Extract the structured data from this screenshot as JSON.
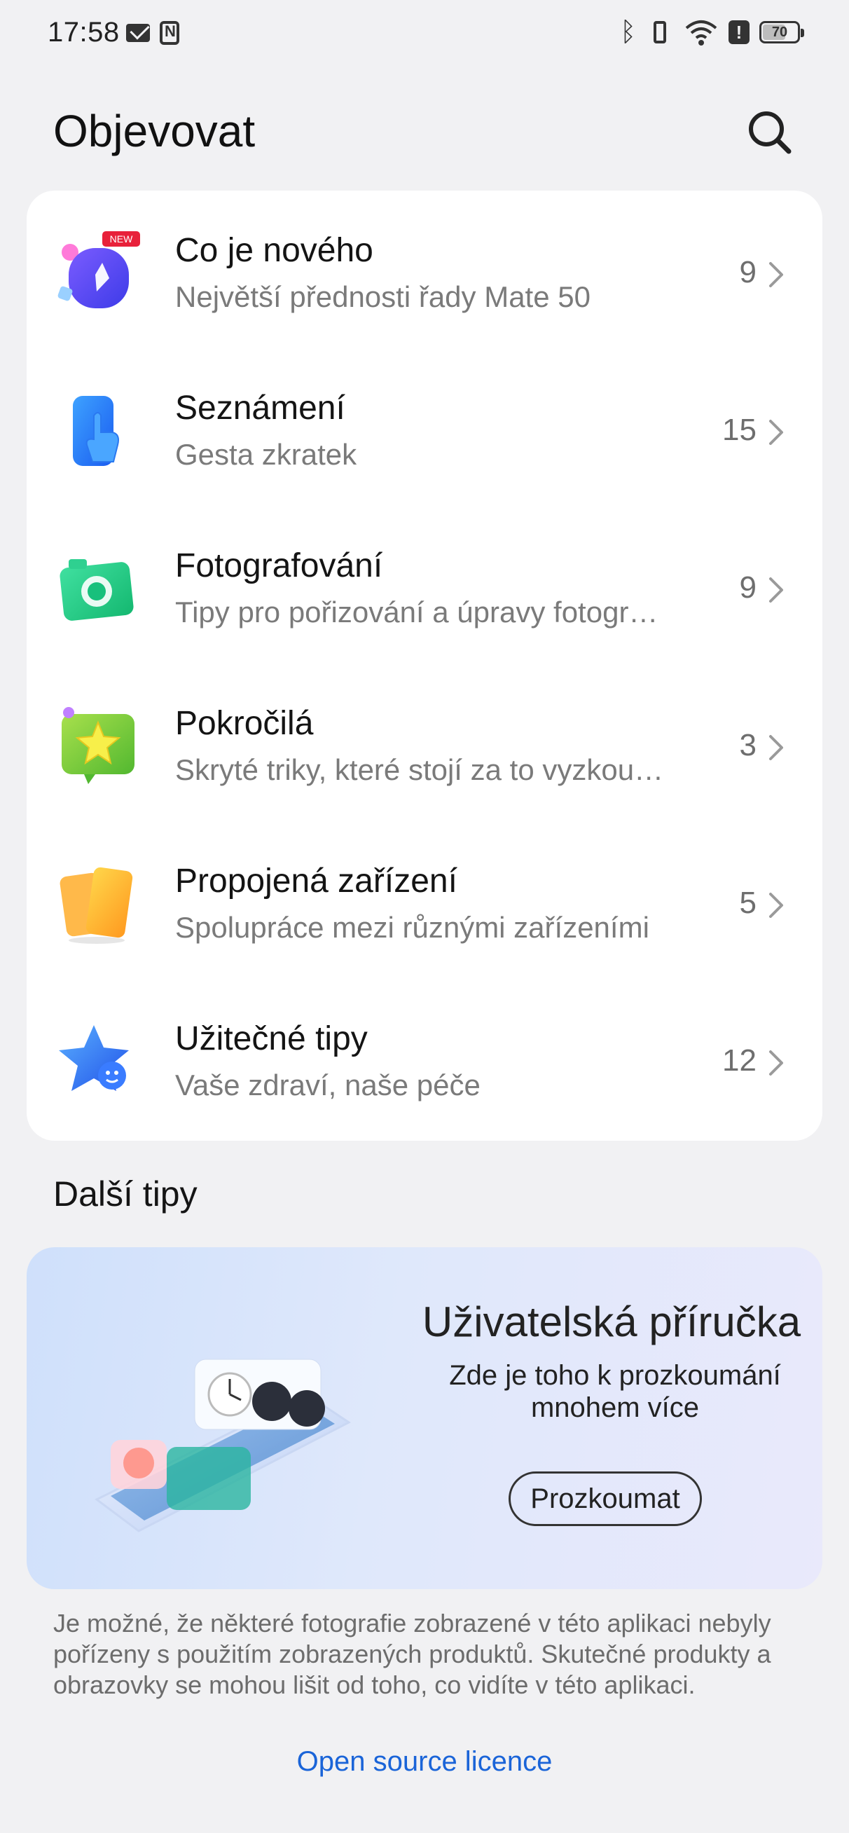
{
  "status_bar": {
    "time": "17:58",
    "battery": "70",
    "battery_level": 0.7
  },
  "header": {
    "title": "Objevovat"
  },
  "categories": [
    {
      "title": "Co je nového",
      "subtitle": "Největší přednosti řady Mate 50",
      "count": "9",
      "badge": "NEW",
      "icon": "whats-new-icon"
    },
    {
      "title": "Seznámení",
      "subtitle": "Gesta zkratek",
      "count": "15",
      "icon": "gesture-hand-icon"
    },
    {
      "title": "Fotografování",
      "subtitle": "Tipy pro pořizování a úpravy fotogr…",
      "count": "9",
      "icon": "camera-icon"
    },
    {
      "title": "Pokročilá",
      "subtitle": "Skryté triky, které stojí za to vyzkou…",
      "count": "3",
      "icon": "star-chat-icon"
    },
    {
      "title": "Propojená zařízení",
      "subtitle": "Spolupráce mezi různými zařízeními",
      "count": "5",
      "icon": "devices-icon"
    },
    {
      "title": "Užitečné tipy",
      "subtitle": "Vaše zdraví, naše péče",
      "count": "12",
      "icon": "star-face-icon"
    }
  ],
  "more_tips": {
    "section_title": "Další tipy",
    "banner": {
      "title": "Uživatelská příručka",
      "subtitle": "Zde je toho k prozkoumání mnohem více",
      "button": "Prozkoumat"
    }
  },
  "footer": {
    "disclaimer": "Je možné, že některé fotografie zobrazené v této aplikaci nebyly pořízeny s použitím zobrazených produktů. Skutečné produkty a obrazovky se mohou lišit od toho, co vidíte v této aplikaci.",
    "link": "Open source licence"
  },
  "colors": {
    "background": "#f1f1f3",
    "card": "#ffffff",
    "link": "#1a64d8",
    "subtitle": "#7a7a7a"
  }
}
